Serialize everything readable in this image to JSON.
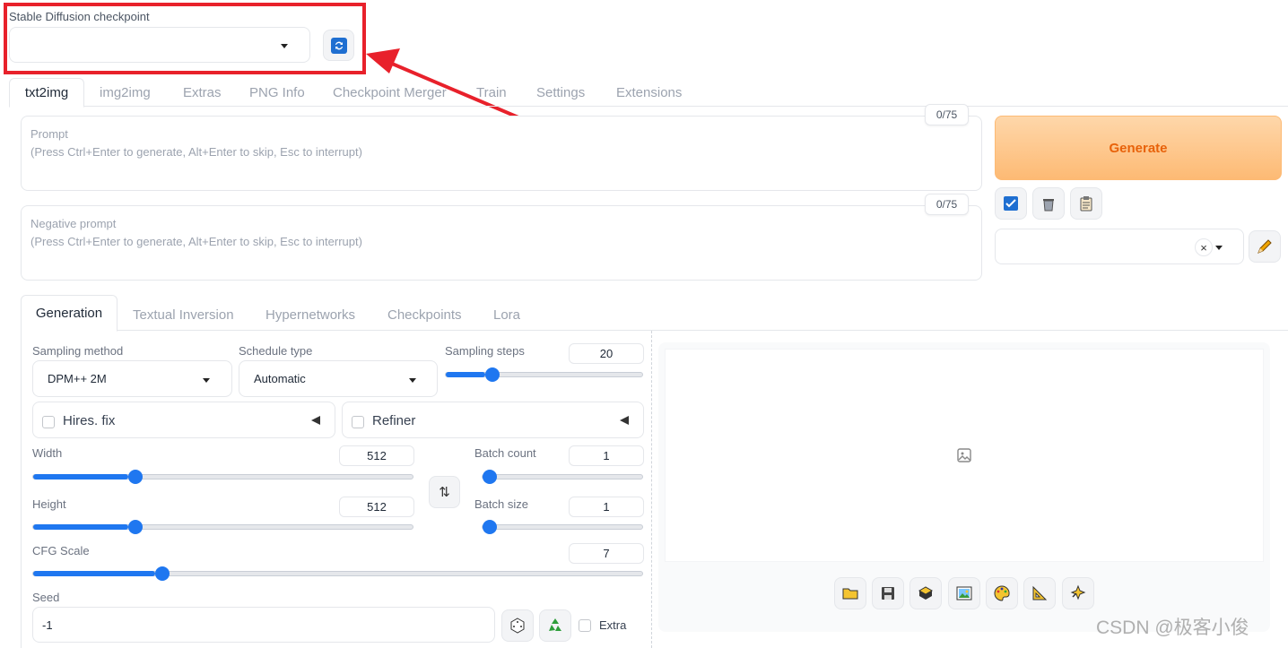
{
  "checkpoint": {
    "label": "Stable Diffusion checkpoint",
    "value": ""
  },
  "top_tabs": [
    "txt2img",
    "img2img",
    "Extras",
    "PNG Info",
    "Checkpoint Merger",
    "Train",
    "Settings",
    "Extensions"
  ],
  "prompt": {
    "label": "Prompt",
    "placeholder": "(Press Ctrl+Enter to generate, Alt+Enter to skip, Esc to interrupt)",
    "counter": "0/75"
  },
  "negative_prompt": {
    "label": "Negative prompt",
    "placeholder": "(Press Ctrl+Enter to generate, Alt+Enter to skip, Esc to interrupt)",
    "counter": "0/75"
  },
  "generate_label": "Generate",
  "styles_clear": "×",
  "sub_tabs": [
    "Generation",
    "Textual Inversion",
    "Hypernetworks",
    "Checkpoints",
    "Lora"
  ],
  "sampling": {
    "method_label": "Sampling method",
    "method_value": "DPM++ 2M",
    "schedule_label": "Schedule type",
    "schedule_value": "Automatic",
    "steps_label": "Sampling steps",
    "steps_value": "20",
    "steps_fraction": 0.2
  },
  "hires": {
    "label": "Hires. fix"
  },
  "refiner": {
    "label": "Refiner"
  },
  "width": {
    "label": "Width",
    "value": "512",
    "fraction": 0.25
  },
  "height": {
    "label": "Height",
    "value": "512",
    "fraction": 0.25
  },
  "batch_count": {
    "label": "Batch count",
    "value": "1",
    "fraction": 0.0
  },
  "batch_size": {
    "label": "Batch size",
    "value": "1",
    "fraction": 0.0
  },
  "cfg": {
    "label": "CFG Scale",
    "value": "7",
    "fraction": 0.2
  },
  "seed": {
    "label": "Seed",
    "value": "-1",
    "extra_label": "Extra"
  },
  "colors": {
    "accent": "#1f77f0",
    "generate_text": "#e8620a",
    "annotation": "#e8212b"
  },
  "watermark": "CSDN @极客小俊"
}
